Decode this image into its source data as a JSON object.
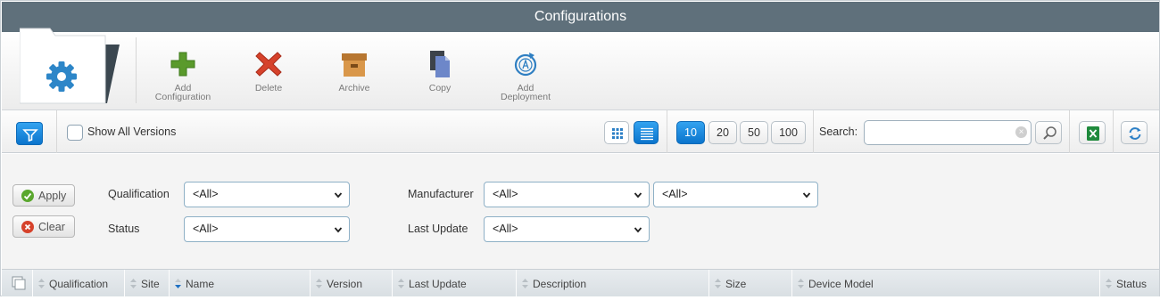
{
  "window": {
    "title": "Configurations"
  },
  "toolbar": {
    "buttons": [
      {
        "id": "add",
        "label_line1": "Add",
        "label_line2": "Configuration"
      },
      {
        "id": "delete",
        "label_line1": "Delete",
        "label_line2": ""
      },
      {
        "id": "archive",
        "label_line1": "Archive",
        "label_line2": ""
      },
      {
        "id": "copy",
        "label_line1": "Copy",
        "label_line2": ""
      },
      {
        "id": "deploy",
        "label_line1": "Add",
        "label_line2": "Deployment"
      }
    ]
  },
  "grid_controls": {
    "show_all_versions": {
      "label": "Show All Versions",
      "checked": false
    },
    "view_mode": "list",
    "page_sizes": [
      "10",
      "20",
      "50",
      "100"
    ],
    "page_size_selected": "10",
    "search": {
      "label": "Search:",
      "value": "",
      "placeholder": ""
    }
  },
  "filters": {
    "apply_label": "Apply",
    "clear_label": "Clear",
    "qualification": {
      "label": "Qualification",
      "value": "<All>"
    },
    "status": {
      "label": "Status",
      "value": "<All>"
    },
    "manufacturer": {
      "label": "Manufacturer",
      "value": "<All>",
      "model_value": "<All>"
    },
    "last_update": {
      "label": "Last Update",
      "value": "<All>"
    }
  },
  "table": {
    "columns": [
      {
        "label": "Qualification",
        "sorted": ""
      },
      {
        "label": "Site",
        "sorted": ""
      },
      {
        "label": "Name",
        "sorted": "desc"
      },
      {
        "label": "Version",
        "sorted": ""
      },
      {
        "label": "Last Update",
        "sorted": ""
      },
      {
        "label": "Description",
        "sorted": ""
      },
      {
        "label": "Size",
        "sorted": ""
      },
      {
        "label": "Device Model",
        "sorted": ""
      },
      {
        "label": "Status",
        "sorted": ""
      }
    ]
  },
  "colors": {
    "titlebar": "#5f707b",
    "accent_blue": "#0b74cc",
    "add_green": "#5a9a2c",
    "delete_red": "#d6422b",
    "archive_tan": "#c8873a",
    "copy_gray": "#555d66",
    "excel_green": "#1f8a3c"
  },
  "icons": {
    "logo": "gear-folder-icon",
    "filter": "funnel-icon",
    "grid_view": "grid-view-icon",
    "list_view": "list-view-icon",
    "search": "magnifier-icon",
    "export": "excel-icon",
    "refresh": "refresh-icon"
  }
}
